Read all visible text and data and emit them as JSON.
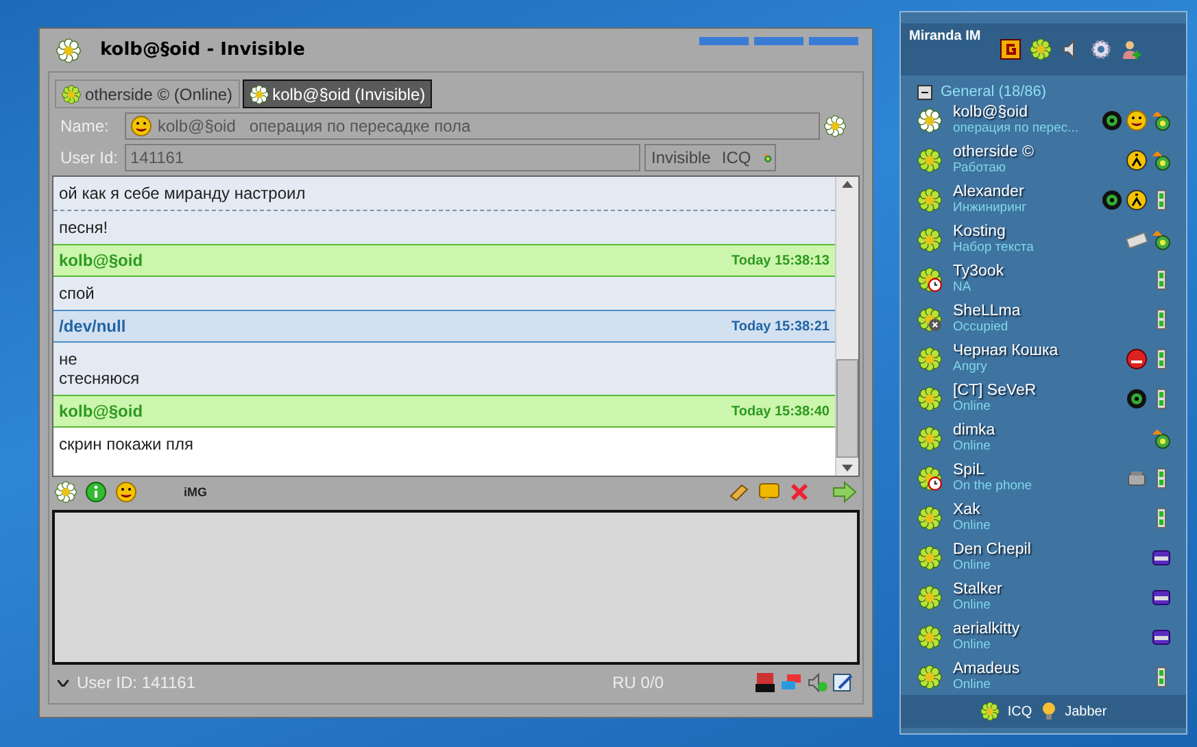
{
  "chat_window": {
    "title": "kolb@§oid - Invisible",
    "tabs": [
      {
        "label": "otherside © (Online)",
        "kind": "online",
        "selected": false
      },
      {
        "label": "kolb@§oid (Invisible)",
        "kind": "invisible",
        "selected": true
      }
    ],
    "name_label": "Name:",
    "name_value": "kolb@§oid   операция по пересадке пола",
    "userid_label": "User Id:",
    "userid_value": "141161",
    "status_text": "Invisible",
    "protocol": "ICQ",
    "messages": [
      {
        "kind": "text",
        "text": "ой как я себе миранду настроил",
        "last": false,
        "dashed": false
      },
      {
        "kind": "text",
        "text": "песня!",
        "last": false,
        "dashed": true
      },
      {
        "kind": "header",
        "sender": "kolb@§oid",
        "time": "Today 15:38:13",
        "outgoing": true
      },
      {
        "kind": "text",
        "text": "спой",
        "last": false,
        "dashed": false
      },
      {
        "kind": "header",
        "sender": "/dev/null",
        "time": "Today 15:38:21",
        "outgoing": false
      },
      {
        "kind": "text",
        "text": "не\nстесняюся",
        "last": false,
        "dashed": false
      },
      {
        "kind": "header",
        "sender": "kolb@§oid",
        "time": "Today 15:38:40",
        "outgoing": true
      },
      {
        "kind": "text",
        "text": "скрин покажи пля",
        "last": true,
        "dashed": false
      }
    ],
    "img_button": "iMG",
    "status_bar": {
      "user_id": "User ID: 141161",
      "layout": "RU 0/0"
    }
  },
  "contact_list": {
    "title": "Miranda IM",
    "group": "General  (18/86)",
    "group_expanded": true,
    "contacts": [
      {
        "name": "kolb@§oid",
        "status": "операция по перес...",
        "kind": "invisible",
        "icons": [
          {
            "kind": "eye"
          },
          {
            "kind": "smiley"
          },
          {
            "kind": "xstatus"
          }
        ]
      },
      {
        "name": "otherside ©",
        "status": "Работаю",
        "kind": "online",
        "icons": [
          {
            "kind": "worker"
          },
          {
            "kind": "xstatus"
          }
        ]
      },
      {
        "name": "Alexander",
        "status": "Инжиниринг",
        "kind": "online",
        "icons": [
          {
            "kind": "eye"
          },
          {
            "kind": "worker"
          },
          {
            "kind": "client"
          }
        ]
      },
      {
        "name": "Kosting",
        "status": "Набор текста",
        "kind": "online",
        "icons": [
          {
            "kind": "keyboard"
          },
          {
            "kind": "xstatus"
          }
        ]
      },
      {
        "name": "Ty3ook",
        "status": "NA",
        "kind": "away",
        "icons": [
          {
            "kind": "client"
          }
        ]
      },
      {
        "name": "SheLLma",
        "status": "Occupied",
        "kind": "occupied",
        "icons": [
          {
            "kind": "client"
          }
        ]
      },
      {
        "name": "Черная Кошка",
        "status": "Angry",
        "kind": "online",
        "icons": [
          {
            "kind": "angry"
          },
          {
            "kind": "client"
          }
        ]
      },
      {
        "name": "[CT] SeVeR",
        "status": "Online",
        "kind": "online",
        "icons": [
          {
            "kind": "eye"
          },
          {
            "kind": "client"
          }
        ]
      },
      {
        "name": "dimka",
        "status": "Online",
        "kind": "online",
        "icons": [
          {
            "kind": "xstatus"
          }
        ]
      },
      {
        "name": "SpiL",
        "status": "On the phone",
        "kind": "away",
        "icons": [
          {
            "kind": "phone"
          },
          {
            "kind": "client"
          }
        ]
      },
      {
        "name": "Xak",
        "status": "Online",
        "kind": "online",
        "icons": [
          {
            "kind": "client"
          }
        ]
      },
      {
        "name": "Den Chepil",
        "status": "Online",
        "kind": "online",
        "icons": [
          {
            "kind": "lib"
          }
        ]
      },
      {
        "name": "Stalker",
        "status": "Online",
        "kind": "online",
        "icons": [
          {
            "kind": "lib"
          }
        ]
      },
      {
        "name": "aerialkitty",
        "status": "Online",
        "kind": "online",
        "icons": [
          {
            "kind": "lib"
          }
        ]
      },
      {
        "name": "Amadeus",
        "status": "Online",
        "kind": "online",
        "icons": [
          {
            "kind": "client"
          }
        ]
      }
    ],
    "footer": [
      "ICQ",
      "Jabber"
    ]
  }
}
